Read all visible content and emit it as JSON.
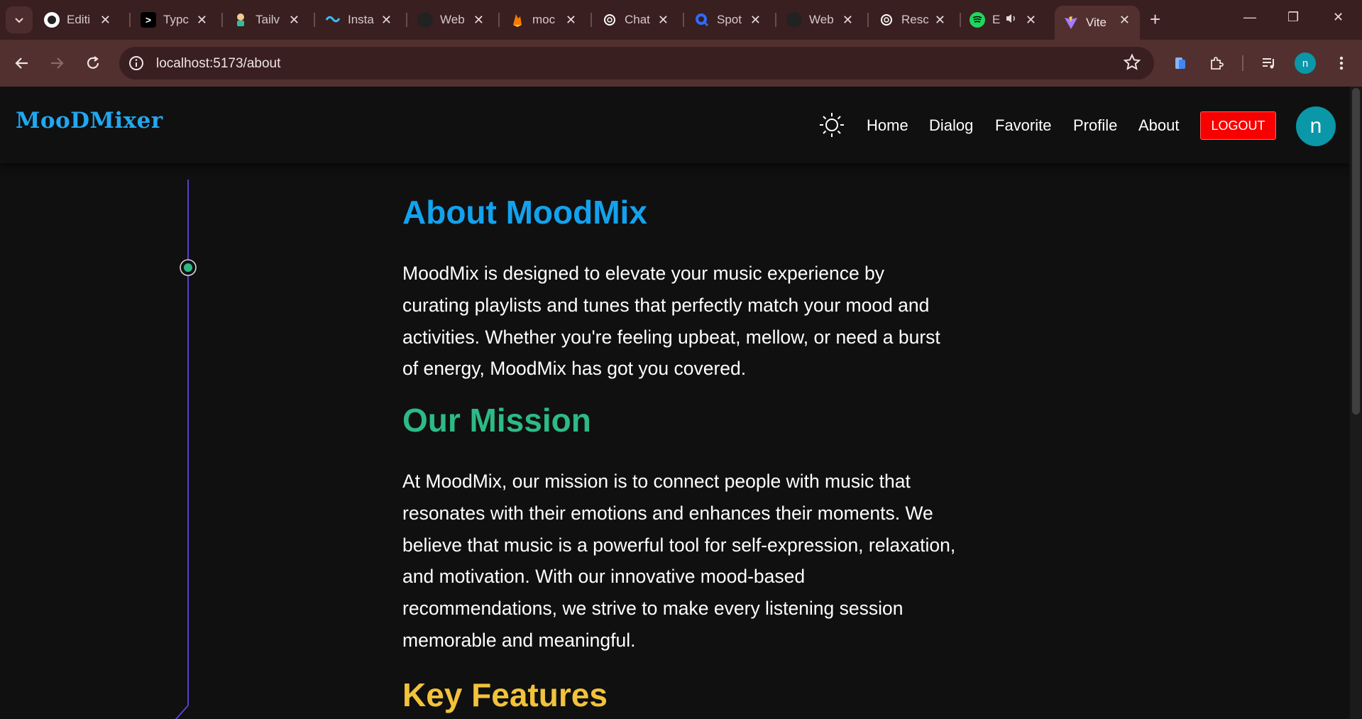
{
  "browser": {
    "tabs": [
      {
        "title": "Editi",
        "icon": "github-icon"
      },
      {
        "title": "Typc",
        "icon": "typing-icon"
      },
      {
        "title": "Tailv",
        "icon": "tailwind-ui-icon"
      },
      {
        "title": "Insta",
        "icon": "tailwind-icon"
      },
      {
        "title": "Web",
        "icon": "web-icon"
      },
      {
        "title": "moc",
        "icon": "firebase-icon"
      },
      {
        "title": "Chat",
        "icon": "openai-icon"
      },
      {
        "title": "Spot",
        "icon": "search-icon"
      },
      {
        "title": "Web",
        "icon": "web-icon"
      },
      {
        "title": "Resc",
        "icon": "openai-icon"
      },
      {
        "title": "E",
        "icon": "spotify-icon"
      },
      {
        "title": "Vite",
        "icon": "vite-icon",
        "active": true
      }
    ],
    "url": "localhost:5173/about",
    "profile_initial": "n"
  },
  "navbar": {
    "logo": "MooDMixer",
    "links": [
      "Home",
      "Dialog",
      "Favorite",
      "Profile",
      "About"
    ],
    "logout_label": "LOGOUT",
    "avatar_initial": "n"
  },
  "content": {
    "about_heading": "About MoodMix",
    "about_text": "MoodMix is designed to elevate your music experience by curating playlists and tunes that perfectly match your mood and activities. Whether you're feeling upbeat, mellow, or need a burst of energy, MoodMix has got you covered.",
    "mission_heading": "Our Mission",
    "mission_text": "At MoodMix, our mission is to connect people with music that resonates with their emotions and enhances their moments. We believe that music is a powerful tool for self-expression, relaxation, and motivation. With our innovative mood-based recommendations, we strive to make every listening session memorable and meaningful.",
    "features_heading": "Key Features"
  },
  "colors": {
    "about_heading": "#12a2ee",
    "mission_heading": "#2dba86",
    "features_heading": "#f2c23b",
    "logo": "#22a7f0",
    "logout": "#f80000",
    "avatar": "#0a97a8",
    "timeline_line": "#5b3fd0",
    "timeline_dot": "#2dba86"
  }
}
